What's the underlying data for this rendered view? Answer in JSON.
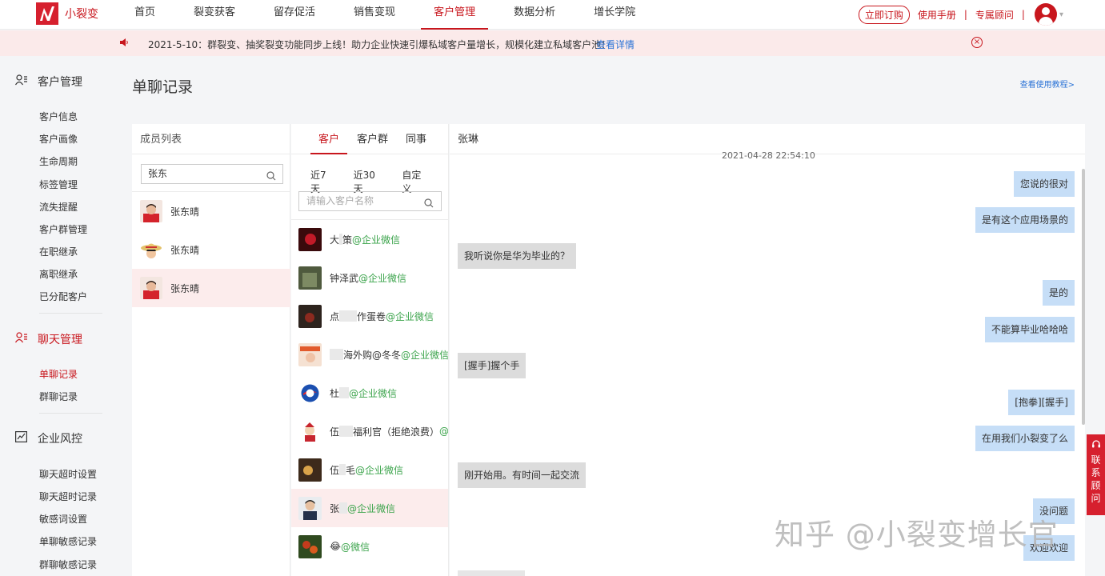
{
  "brand": {
    "name": "小裂变",
    "accent": "#c8161d"
  },
  "nav": {
    "items": [
      {
        "label": "首页"
      },
      {
        "label": "裂变获客"
      },
      {
        "label": "留存促活"
      },
      {
        "label": "销售变现"
      },
      {
        "label": "客户管理",
        "active": true
      },
      {
        "label": "数据分析"
      },
      {
        "label": "增长学院"
      }
    ],
    "subscribe_label": "立即订购",
    "manual_label": "使用手册",
    "advisor_label": "专属顾问",
    "separator": "|"
  },
  "notice": {
    "text": "2021-5-10：群裂变、抽奖裂变功能同步上线！助力企业快速引爆私域客户量增长，规模化建立私域客户池！",
    "link_label": "查看详情",
    "close_glyph": "×"
  },
  "sidebar": {
    "groups": [
      {
        "label": "客户管理",
        "items": [
          "客户信息",
          "客户画像",
          "生命周期",
          "标签管理",
          "流失提醒",
          "客户群管理",
          "在职继承",
          "离职继承",
          "已分配客户"
        ]
      },
      {
        "label": "聊天管理",
        "items": [
          "单聊记录",
          "群聊记录"
        ],
        "active_item": "单聊记录"
      },
      {
        "label": "企业风控",
        "items": [
          "聊天超时设置",
          "聊天超时记录",
          "敏感词设置",
          "单聊敏感记录",
          "群聊敏感记录"
        ]
      }
    ]
  },
  "page": {
    "title": "单聊记录",
    "tutorial_label": "查看使用教程>"
  },
  "members": {
    "header": "成员列表",
    "search_value": "张东",
    "list": [
      {
        "name": "张东晴",
        "avatar": "red-shirt-avatar"
      },
      {
        "name": "张东晴",
        "avatar": "straw-hat-avatar"
      },
      {
        "name": "张东晴",
        "avatar": "red-shirt-avatar",
        "active": true
      }
    ]
  },
  "customers": {
    "tabs": [
      "客户",
      "客户群",
      "同事"
    ],
    "active_tab": "客户",
    "ranges": [
      "近7天",
      "近30天",
      "自定义"
    ],
    "search_placeholder": "请输入客户名称",
    "list": [
      {
        "name": "大",
        "name_tail": "策",
        "tag": "@企业微信"
      },
      {
        "name": "钟",
        "name_tail": "泽武",
        "tag": "@企业微信"
      },
      {
        "name": "点",
        "name_tail": "作蛋卷",
        "tag": "@企业微信"
      },
      {
        "name": "",
        "name_tail": "海外购@冬冬",
        "tag": "@企业微信"
      },
      {
        "name": "杜",
        "name_tail": "",
        "tag": "@企业微信"
      },
      {
        "name": "伍",
        "name_tail": "福利官（拒绝浪费）",
        "tag": "@"
      },
      {
        "name": "伍",
        "name_tail": "毛",
        "tag": "@企业微信"
      },
      {
        "name": "张",
        "name_tail": "",
        "tag": "@企业微信",
        "active": true
      },
      {
        "name": "😂",
        "name_tail": "",
        "tag": "@微信"
      }
    ]
  },
  "chat": {
    "contact_name": "张琳",
    "timestamp": "2021-04-28 22:54:10",
    "messages": [
      {
        "dir": "out",
        "text": "您说的很对"
      },
      {
        "dir": "out",
        "text": "是有这个应用场景的"
      },
      {
        "dir": "in",
        "text": "我听说你是华为毕业的？"
      },
      {
        "dir": "out",
        "text": "是的"
      },
      {
        "dir": "out",
        "text": "不能算毕业哈哈哈"
      },
      {
        "dir": "in",
        "text": "[握手]握个手"
      },
      {
        "dir": "out",
        "text": "[抱拳][握手]"
      },
      {
        "dir": "out",
        "text": "在用我们小裂变了么"
      },
      {
        "dir": "in",
        "text": "刚开始用。有时间一起交流"
      },
      {
        "dir": "out",
        "text": "没问题"
      },
      {
        "dir": "out",
        "text": "欢迎欢迎"
      }
    ]
  },
  "contact_button": "联系顾问",
  "watermark": "知乎 @小裂变增长官"
}
